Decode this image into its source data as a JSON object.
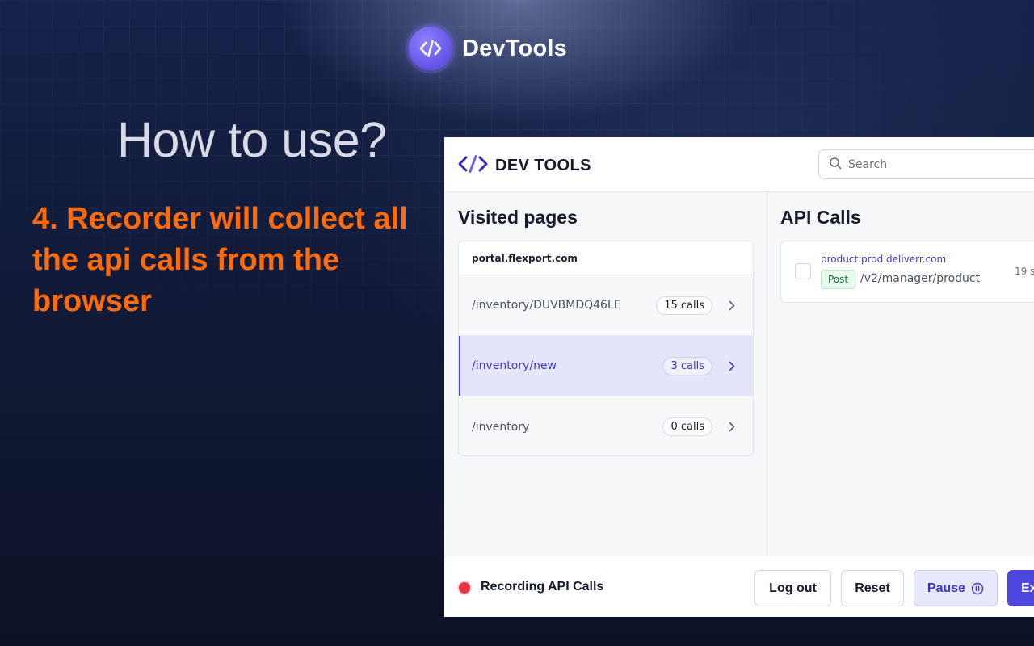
{
  "brand": {
    "name": "DevTools"
  },
  "headline": "How to use?",
  "step_text": "4. Recorder will collect all the api calls from the browser",
  "app": {
    "title": "DEV TOOLS",
    "search": {
      "placeholder": "Search"
    },
    "visited_pages": {
      "title": "Visited pages",
      "domain": "portal.flexport.com",
      "items": [
        {
          "path": "/inventory/DUVBMDQ46LE",
          "calls": "15 calls",
          "active": false
        },
        {
          "path": "/inventory/new",
          "calls": "3 calls",
          "active": true
        },
        {
          "path": "/inventory",
          "calls": "0 calls",
          "active": false
        }
      ]
    },
    "api_calls": {
      "title": "API Calls",
      "items": [
        {
          "host": "product.prod.deliverr.com",
          "method": "Post",
          "path": "/v2/manager/product",
          "time": "19 se"
        }
      ]
    },
    "footer": {
      "recording_label": "Recording API Calls",
      "logout_label": "Log out",
      "reset_label": "Reset",
      "pause_label": "Pause",
      "export_label": "Ex"
    }
  },
  "colors": {
    "accent": "#4d47e0",
    "step_orange": "#ff6b0a",
    "recording_red": "#ea3343",
    "method_green_bg": "#e9fbef"
  },
  "icons": [
    "code-brackets-icon",
    "search-icon",
    "chevron-right-icon",
    "pause-circle-icon",
    "recording-dot-icon"
  ]
}
